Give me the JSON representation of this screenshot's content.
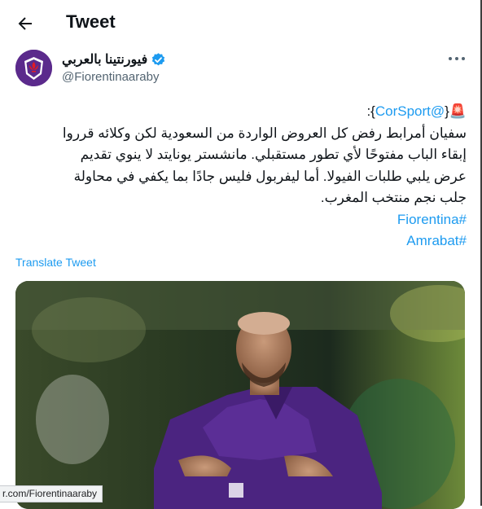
{
  "header": {
    "title": "Tweet",
    "back_icon": "arrow-left-icon"
  },
  "author": {
    "name": "فيورنتينا بالعربي",
    "handle": "@Fiorentinaaraby",
    "verified_icon": "verified-badge-icon",
    "avatar_icon": "fiorentina-lily-logo"
  },
  "tweet": {
    "mention": "@CorSport",
    "line1_end": "}:",
    "lines": [
      "سفيان أمرابط رفض كل العروض الواردة من السعودية لكن وكلائه قرروا",
      "إبقاء الباب مفتوحًا لأي تطور مستقبلي. مانشستر يونايتد لا ينوي تقديم",
      "عرض يلبي طلبات الفيولا. أما ليفربول فليس جادًا بما يكفي في محاولة",
      "جلب نجم منتخب المغرب."
    ],
    "hashtags": [
      "#Fiorentina",
      "#Amrabat"
    ],
    "translate_label": "Translate Tweet"
  },
  "status_bar": {
    "url": "r.com/Fiorentinaaraby"
  },
  "colors": {
    "link": "#1d9bf0",
    "secondary": "#536471",
    "jersey": "#5b2a8c"
  }
}
